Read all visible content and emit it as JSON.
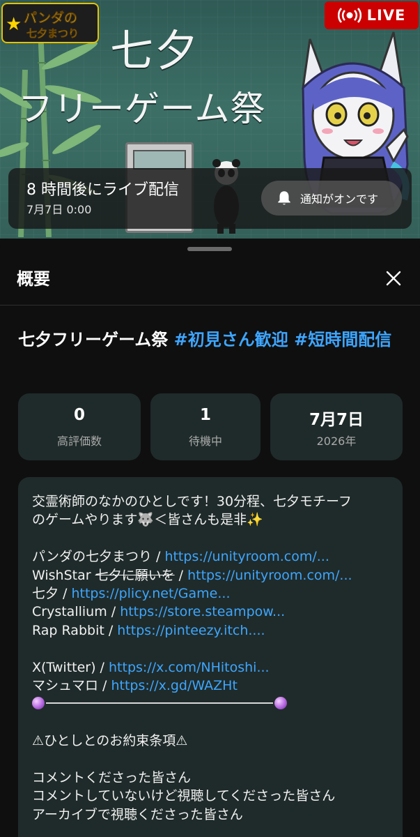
{
  "banner": {
    "logo_line1": "パンダの",
    "logo_line2": "七夕まつり",
    "title_line1": "七夕",
    "title_line2": "フリーゲーム祭",
    "live_label": "LIVE"
  },
  "schedule": {
    "countdown": "8 時間後にライブ配信",
    "date": "7月7日 0:00",
    "notify_label": "通知がオンです"
  },
  "sheet": {
    "title": "概要"
  },
  "video": {
    "title_main": "七夕フリーゲーム祭",
    "hashtag1": " #初見さん歓迎",
    "hashtag2": " #短時間配信"
  },
  "stats": {
    "likes_value": "0",
    "likes_label": "高評価数",
    "waiting_value": "1",
    "waiting_label": "待機中",
    "date_value": "7月7日",
    "date_label": "2026年"
  },
  "description": {
    "line1": "交霊術師のなかのひとしです！30分程、七夕モチーフ",
    "line2": "のゲームやります🐺＜皆さんも是非✨",
    "game1_name": "パンダの七夕まつり / ",
    "game1_link": "https://unityroom.com/...",
    "game2_name": "WishStar ",
    "game2_strike": "七夕に願いを",
    "game2_sep": " / ",
    "game2_link": "https://unityroom.com/...",
    "game3_name": "七夕 / ",
    "game3_link": "https://plicy.net/Game...",
    "game4_name": "Crystallium / ",
    "game4_link": "https://store.steampow...",
    "game5_name": "Rap Rabbit / ",
    "game5_link": "https://pinteezy.itch....",
    "twitter_name": "X(Twitter) / ",
    "twitter_link": "https://x.com/NHitoshi...",
    "marshmallow_name": "マシュマロ / ",
    "marshmallow_link": "https://x.gd/WAZHt",
    "rules_heading": "⚠ひとしとのお約束条項⚠",
    "thanks1": "コメントくださった皆さん",
    "thanks2": "コメントしていないけど視聴してくださった皆さん",
    "thanks3": "アーカイブで視聴くださった皆さん"
  },
  "colors": {
    "live_red": "#cc0000",
    "link_blue": "#3ea6ff",
    "card_bg": "#1f2b2a",
    "sheet_bg": "#0f0f0f"
  }
}
